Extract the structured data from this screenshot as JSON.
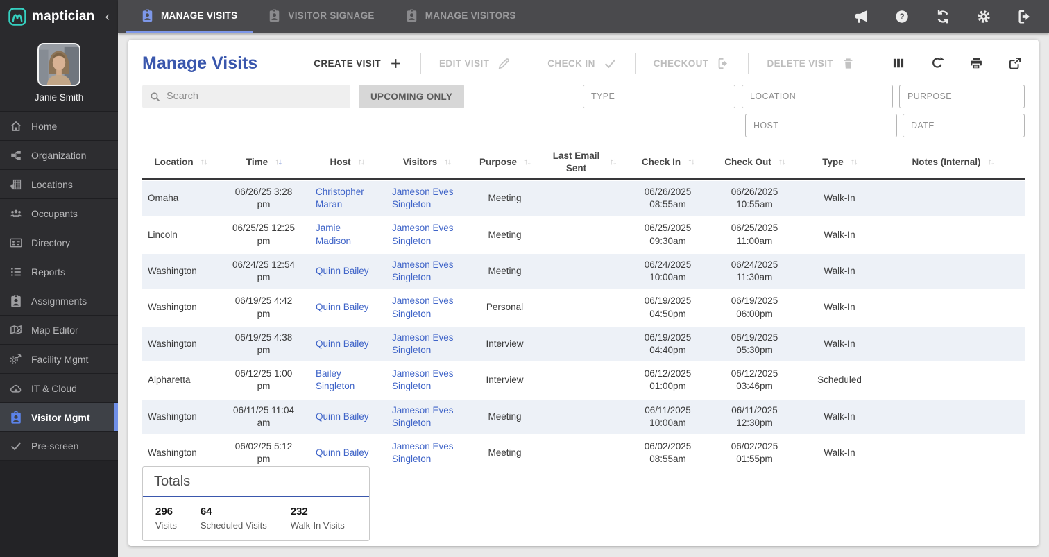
{
  "brand": {
    "name": "maptician"
  },
  "user": {
    "name": "Janie Smith"
  },
  "sidebar": {
    "items": [
      {
        "label": "Home",
        "icon": "home-icon",
        "active": false
      },
      {
        "label": "Organization",
        "icon": "organization-icon",
        "active": false
      },
      {
        "label": "Locations",
        "icon": "locations-icon",
        "active": false
      },
      {
        "label": "Occupants",
        "icon": "occupants-icon",
        "active": false
      },
      {
        "label": "Directory",
        "icon": "directory-icon",
        "active": false
      },
      {
        "label": "Reports",
        "icon": "reports-icon",
        "active": false
      },
      {
        "label": "Assignments",
        "icon": "assignments-icon",
        "active": false
      },
      {
        "label": "Map Editor",
        "icon": "map-editor-icon",
        "active": false
      },
      {
        "label": "Facility Mgmt",
        "icon": "facility-icon",
        "active": false
      },
      {
        "label": "IT & Cloud",
        "icon": "cloud-icon",
        "active": false
      },
      {
        "label": "Visitor Mgmt",
        "icon": "visitor-badge-icon",
        "active": true
      },
      {
        "label": "Pre-screen",
        "icon": "check-icon",
        "active": false
      }
    ]
  },
  "topbar": {
    "tabs": [
      {
        "label": "MANAGE VISITS",
        "active": true
      },
      {
        "label": "VISITOR SIGNAGE",
        "active": false
      },
      {
        "label": "MANAGE VISITORS",
        "active": false
      }
    ],
    "icons": [
      "announcements-icon",
      "help-icon",
      "sync-icon",
      "settings-icon",
      "sign-out-icon"
    ]
  },
  "page": {
    "title": "Manage Visits"
  },
  "toolbar": {
    "create_label": "CREATE VISIT",
    "edit_label": "EDIT VISIT",
    "check_in_label": "CHECK IN",
    "checkout_label": "CHECKOUT",
    "delete_label": "DELETE VISIT"
  },
  "filters": {
    "search_placeholder": "Search",
    "upcoming_only_label": "UPCOMING ONLY",
    "type_placeholder": "TYPE",
    "location_placeholder": "LOCATION",
    "purpose_placeholder": "PURPOSE",
    "host_placeholder": "HOST",
    "date_placeholder": "DATE"
  },
  "table": {
    "columns": [
      {
        "label": "Location",
        "sort": "none"
      },
      {
        "label": "Time",
        "sort": "desc"
      },
      {
        "label": "Host",
        "sort": "none"
      },
      {
        "label": "Visitors",
        "sort": "none"
      },
      {
        "label": "Purpose",
        "sort": "none"
      },
      {
        "label": "Last Email Sent",
        "sort": "none"
      },
      {
        "label": "Check In",
        "sort": "none"
      },
      {
        "label": "Check Out",
        "sort": "none"
      },
      {
        "label": "Type",
        "sort": "none"
      },
      {
        "label": "Notes (Internal)",
        "sort": "none"
      }
    ],
    "rows": [
      {
        "location": "Omaha",
        "time": "06/26/25 3:28 pm",
        "host": "Christopher Maran",
        "visitors": "Jameson Eves Singleton",
        "purpose": "Meeting",
        "last_email_sent": "",
        "check_in": "06/26/2025 08:55am",
        "check_out": "06/26/2025 10:55am",
        "type": "Walk-In",
        "notes": ""
      },
      {
        "location": "Lincoln",
        "time": "06/25/25 12:25 pm",
        "host": "Jamie Madison",
        "visitors": "Jameson Eves Singleton",
        "purpose": "Meeting",
        "last_email_sent": "",
        "check_in": "06/25/2025 09:30am",
        "check_out": "06/25/2025 11:00am",
        "type": "Walk-In",
        "notes": ""
      },
      {
        "location": "Washington",
        "time": "06/24/25 12:54 pm",
        "host": "Quinn Bailey",
        "visitors": "Jameson Eves Singleton",
        "purpose": "Meeting",
        "last_email_sent": "",
        "check_in": "06/24/2025 10:00am",
        "check_out": "06/24/2025 11:30am",
        "type": "Walk-In",
        "notes": ""
      },
      {
        "location": "Washington",
        "time": "06/19/25 4:42 pm",
        "host": "Quinn Bailey",
        "visitors": "Jameson Eves Singleton",
        "purpose": "Personal",
        "last_email_sent": "",
        "check_in": "06/19/2025 04:50pm",
        "check_out": "06/19/2025 06:00pm",
        "type": "Walk-In",
        "notes": ""
      },
      {
        "location": "Washington",
        "time": "06/19/25 4:38 pm",
        "host": "Quinn Bailey",
        "visitors": "Jameson Eves Singleton",
        "purpose": "Interview",
        "last_email_sent": "",
        "check_in": "06/19/2025 04:40pm",
        "check_out": "06/19/2025 05:30pm",
        "type": "Walk-In",
        "notes": ""
      },
      {
        "location": "Alpharetta",
        "time": "06/12/25 1:00 pm",
        "host": "Bailey Singleton",
        "visitors": "Jameson Eves Singleton",
        "purpose": "Interview",
        "last_email_sent": "",
        "check_in": "06/12/2025 01:00pm",
        "check_out": "06/12/2025 03:46pm",
        "type": "Scheduled",
        "notes": ""
      },
      {
        "location": "Washington",
        "time": "06/11/25 11:04 am",
        "host": "Quinn Bailey",
        "visitors": "Jameson Eves Singleton",
        "purpose": "Meeting",
        "last_email_sent": "",
        "check_in": "06/11/2025 10:00am",
        "check_out": "06/11/2025 12:30pm",
        "type": "Walk-In",
        "notes": ""
      },
      {
        "location": "Washington",
        "time": "06/02/25 5:12 pm",
        "host": "Quinn Bailey",
        "visitors": "Jameson Eves Singleton",
        "purpose": "Meeting",
        "last_email_sent": "",
        "check_in": "06/02/2025 08:55am",
        "check_out": "06/02/2025 01:55pm",
        "type": "Walk-In",
        "notes": ""
      }
    ]
  },
  "totals": {
    "title": "Totals",
    "stats": [
      {
        "value": "296",
        "label": "Visits"
      },
      {
        "value": "64",
        "label": "Scheduled Visits"
      },
      {
        "value": "232",
        "label": "Walk-In Visits"
      }
    ]
  },
  "colors": {
    "accent_blue": "#3a57ad",
    "link_blue": "#3f64c8",
    "tab_underline": "#7d97e8",
    "brand_teal": "#35d0c0",
    "row_alt": "#edf1f7",
    "sidebar_bg": "#232326",
    "topbar_bg": "#4a4a4d"
  }
}
